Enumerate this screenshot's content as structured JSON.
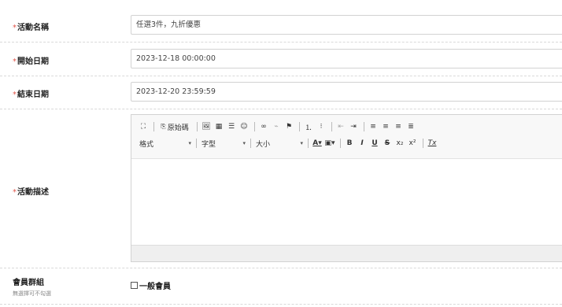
{
  "form": {
    "required_mark": "*",
    "name": {
      "label": "活動名稱",
      "value": "任選3件，九折優惠"
    },
    "start": {
      "label": "開始日期",
      "value": "2023-12-18 00:00:00"
    },
    "end": {
      "label": "結束日期",
      "value": "2023-12-20 23:59:59"
    },
    "desc": {
      "label": "活動描述"
    },
    "group": {
      "label": "會員群組",
      "hint": "無選擇可不勾選",
      "option": "一般會員",
      "checked": false
    }
  },
  "editor": {
    "source_label": "原始碼",
    "format_label": "格式",
    "font_label": "字型",
    "size_label": "大小",
    "icons": [
      "maximize-icon",
      "source-icon",
      "image-icon",
      "table-icon",
      "horizontal-line-icon",
      "emoji-icon",
      "link-icon",
      "unlink-icon",
      "anchor-icon",
      "numbered-list-icon",
      "bulleted-list-icon",
      "outdent-icon",
      "indent-icon",
      "align-left-icon",
      "align-center-icon",
      "align-right-icon",
      "align-justify-icon",
      "text-color-icon",
      "bg-color-icon",
      "bold-icon",
      "italic-icon",
      "underline-icon",
      "strike-icon",
      "subscript-icon",
      "superscript-icon",
      "remove-format-icon"
    ]
  }
}
